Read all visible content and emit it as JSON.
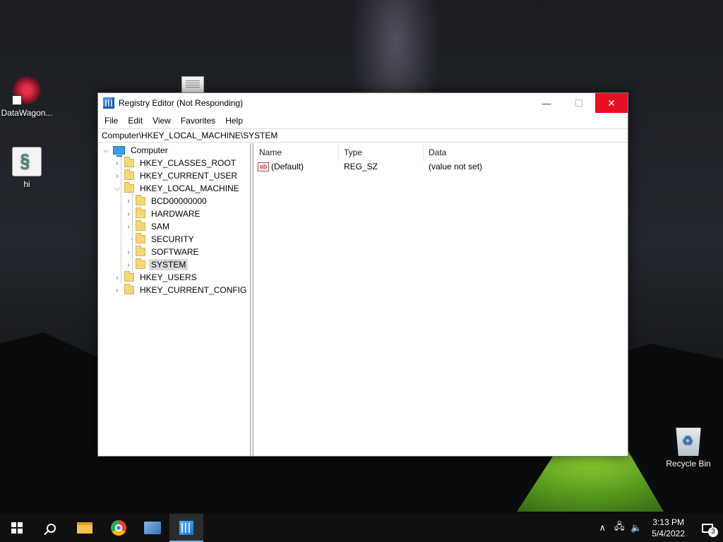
{
  "desktop": {
    "icons": [
      {
        "label": "DataWagon..."
      },
      {
        "label": "hi"
      },
      {
        "label": "Recycle Bin"
      }
    ]
  },
  "window": {
    "title": "Registry Editor (Not Responding)",
    "controls": {
      "minimize": "—",
      "close": "✕"
    },
    "menu": [
      "File",
      "Edit",
      "View",
      "Favorites",
      "Help"
    ],
    "address": "Computer\\HKEY_LOCAL_MACHINE\\SYSTEM",
    "tree": {
      "root": "Computer",
      "hives": [
        "HKEY_CLASSES_ROOT",
        "HKEY_CURRENT_USER",
        "HKEY_LOCAL_MACHINE",
        "HKEY_USERS",
        "HKEY_CURRENT_CONFIG"
      ],
      "hklm_children": [
        "BCD00000000",
        "HARDWARE",
        "SAM",
        "SECURITY",
        "SOFTWARE",
        "SYSTEM"
      ],
      "selected": "SYSTEM"
    },
    "columns": [
      "Name",
      "Type",
      "Data"
    ],
    "values": [
      {
        "icon": "ab",
        "name": "(Default)",
        "type": "REG_SZ",
        "data": "(value not set)"
      }
    ]
  },
  "taskbar": {
    "pinned": [
      "start-button",
      "search",
      "file-explorer",
      "chrome",
      "network-app",
      "registry-editor"
    ],
    "active": "registry-editor",
    "tray": {
      "chevron": "∧",
      "time": "3:13 PM",
      "date": "5/4/2022",
      "notifications": "3"
    }
  },
  "colors": {
    "close_button": "#e81123",
    "taskbar": "#101010",
    "selection": "#d9d9d9",
    "folder": "#f4d77a"
  }
}
